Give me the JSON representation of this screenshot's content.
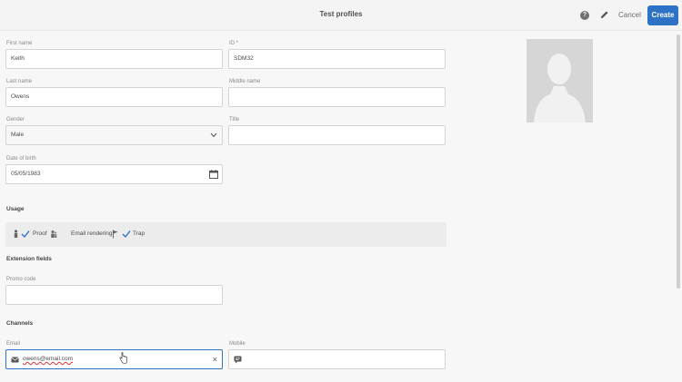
{
  "header": {
    "title": "Test profiles",
    "help_icon": "help-icon",
    "edit_icon": "pencil-icon",
    "cancel_label": "Cancel",
    "create_label": "Create",
    "accent_color": "#2d72c4"
  },
  "form": {
    "first_name": {
      "label": "First name",
      "value": "Keith"
    },
    "id": {
      "label": "ID *",
      "value": "SDM32"
    },
    "last_name": {
      "label": "Last name",
      "value": "Owens"
    },
    "middle_name": {
      "label": "Middle name",
      "value": ""
    },
    "gender": {
      "label": "Gender",
      "value": "Male"
    },
    "title": {
      "label": "Title",
      "value": ""
    },
    "date_of_birth": {
      "label": "Date of birth",
      "value": "05/05/1983"
    }
  },
  "usage": {
    "section_title": "Usage",
    "proof_label": "Proof",
    "proof_checked": true,
    "email_rendering_label": "Email rendering",
    "trap_label": "Trap",
    "trap_checked": true
  },
  "extension": {
    "section_title": "Extension fields",
    "promo_code": {
      "label": "Promo code",
      "value": ""
    }
  },
  "channels": {
    "section_title": "Channels",
    "email": {
      "label": "Email",
      "value": "owens@email.com"
    },
    "mobile": {
      "label": "Mobile",
      "value": ""
    }
  }
}
